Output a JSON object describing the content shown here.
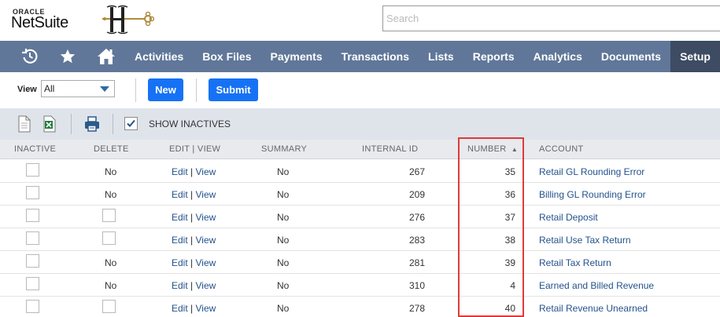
{
  "header": {
    "logo_top": "ORACLE",
    "logo_main": "NetSuite",
    "search_placeholder": "Search"
  },
  "nav": {
    "icons": [
      "history-icon",
      "star-icon",
      "home-icon"
    ],
    "items": [
      {
        "label": "Activities",
        "active": false
      },
      {
        "label": "Box Files",
        "active": false
      },
      {
        "label": "Payments",
        "active": false
      },
      {
        "label": "Transactions",
        "active": false
      },
      {
        "label": "Lists",
        "active": false
      },
      {
        "label": "Reports",
        "active": false
      },
      {
        "label": "Analytics",
        "active": false
      },
      {
        "label": "Documents",
        "active": false
      },
      {
        "label": "Setup",
        "active": true
      }
    ]
  },
  "actions": {
    "view_label": "View",
    "view_value": "All",
    "new_label": "New",
    "submit_label": "Submit"
  },
  "toolbar": {
    "show_inactives_label": "SHOW INACTIVES",
    "show_inactives_checked": true
  },
  "table": {
    "columns": [
      "INACTIVE",
      "DELETE",
      "EDIT | VIEW",
      "SUMMARY",
      "INTERNAL ID",
      "NUMBER",
      "ACCOUNT"
    ],
    "sort_indicator": "▲",
    "edit_label": "Edit",
    "view_label": "View",
    "divider": "|",
    "rows": [
      {
        "delete": "No",
        "summary": "No",
        "internal_id": "267",
        "number": "35",
        "account": "Retail GL Rounding Error"
      },
      {
        "delete": "No",
        "summary": "No",
        "internal_id": "209",
        "number": "36",
        "account": "Billing GL Rounding Error"
      },
      {
        "delete": "",
        "summary": "No",
        "internal_id": "276",
        "number": "37",
        "account": "Retail Deposit"
      },
      {
        "delete": "",
        "summary": "No",
        "internal_id": "283",
        "number": "38",
        "account": "Retail Use Tax Return"
      },
      {
        "delete": "No",
        "summary": "No",
        "internal_id": "281",
        "number": "39",
        "account": "Retail Tax Return"
      },
      {
        "delete": "No",
        "summary": "No",
        "internal_id": "310",
        "number": "4",
        "account": "Earned and Billed Revenue"
      },
      {
        "delete": "",
        "summary": "No",
        "internal_id": "278",
        "number": "40",
        "account": "Retail Revenue Unearned"
      }
    ]
  },
  "colors": {
    "nav_bg": "#607799",
    "nav_active": "#3d4b63",
    "button_blue": "#1672f5",
    "link": "#24528c",
    "highlight": "#e03a3a"
  }
}
